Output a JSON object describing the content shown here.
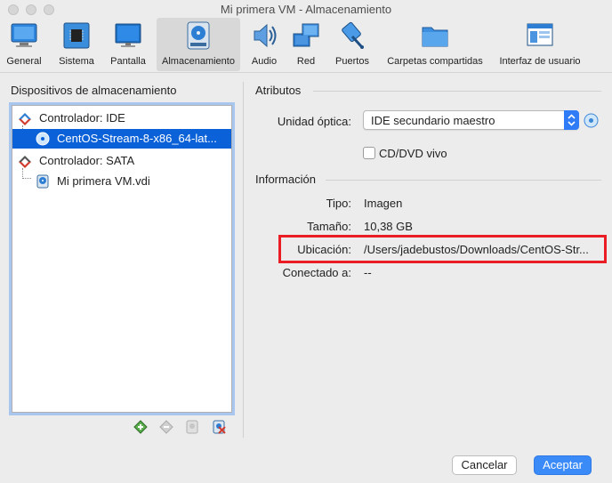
{
  "window": {
    "title": "Mi primera VM - Almacenamiento"
  },
  "toolbar": {
    "items": [
      {
        "label": "General",
        "icon": "general-icon"
      },
      {
        "label": "Sistema",
        "icon": "chip-icon"
      },
      {
        "label": "Pantalla",
        "icon": "monitor-icon"
      },
      {
        "label": "Almacenamiento",
        "icon": "disk-icon",
        "selected": true
      },
      {
        "label": "Audio",
        "icon": "speaker-icon"
      },
      {
        "label": "Red",
        "icon": "network-icon"
      },
      {
        "label": "Puertos",
        "icon": "usb-icon"
      },
      {
        "label": "Carpetas compartidas",
        "icon": "folder-icon"
      },
      {
        "label": "Interfaz de usuario",
        "icon": "window-icon"
      }
    ]
  },
  "left": {
    "title": "Dispositivos de almacenamiento",
    "tree": [
      {
        "label": "Controlador: IDE",
        "type": "controller"
      },
      {
        "label": "CentOS-Stream-8-x86_64-lat...",
        "type": "optical",
        "selected": true
      },
      {
        "label": "Controlador: SATA",
        "type": "controller"
      },
      {
        "label": "Mi primera VM.vdi",
        "type": "hdd"
      }
    ]
  },
  "right": {
    "attributes_title": "Atributos",
    "optical_label": "Unidad óptica:",
    "optical_value": "IDE secundario maestro",
    "live_cd_label": "CD/DVD vivo",
    "info_title": "Información",
    "info": {
      "type_label": "Tipo:",
      "type_value": "Imagen",
      "size_label": "Tamaño:",
      "size_value": "10,38 GB",
      "location_label": "Ubicación:",
      "location_value": "/Users/jadebustos/Downloads/CentOS-Str...",
      "attached_label": "Conectado a:",
      "attached_value": "--"
    }
  },
  "buttons": {
    "cancel": "Cancelar",
    "ok": "Aceptar"
  },
  "colors": {
    "accent": "#2f7cf6",
    "selection": "#0b62d8",
    "highlight": "#ea1c24"
  }
}
